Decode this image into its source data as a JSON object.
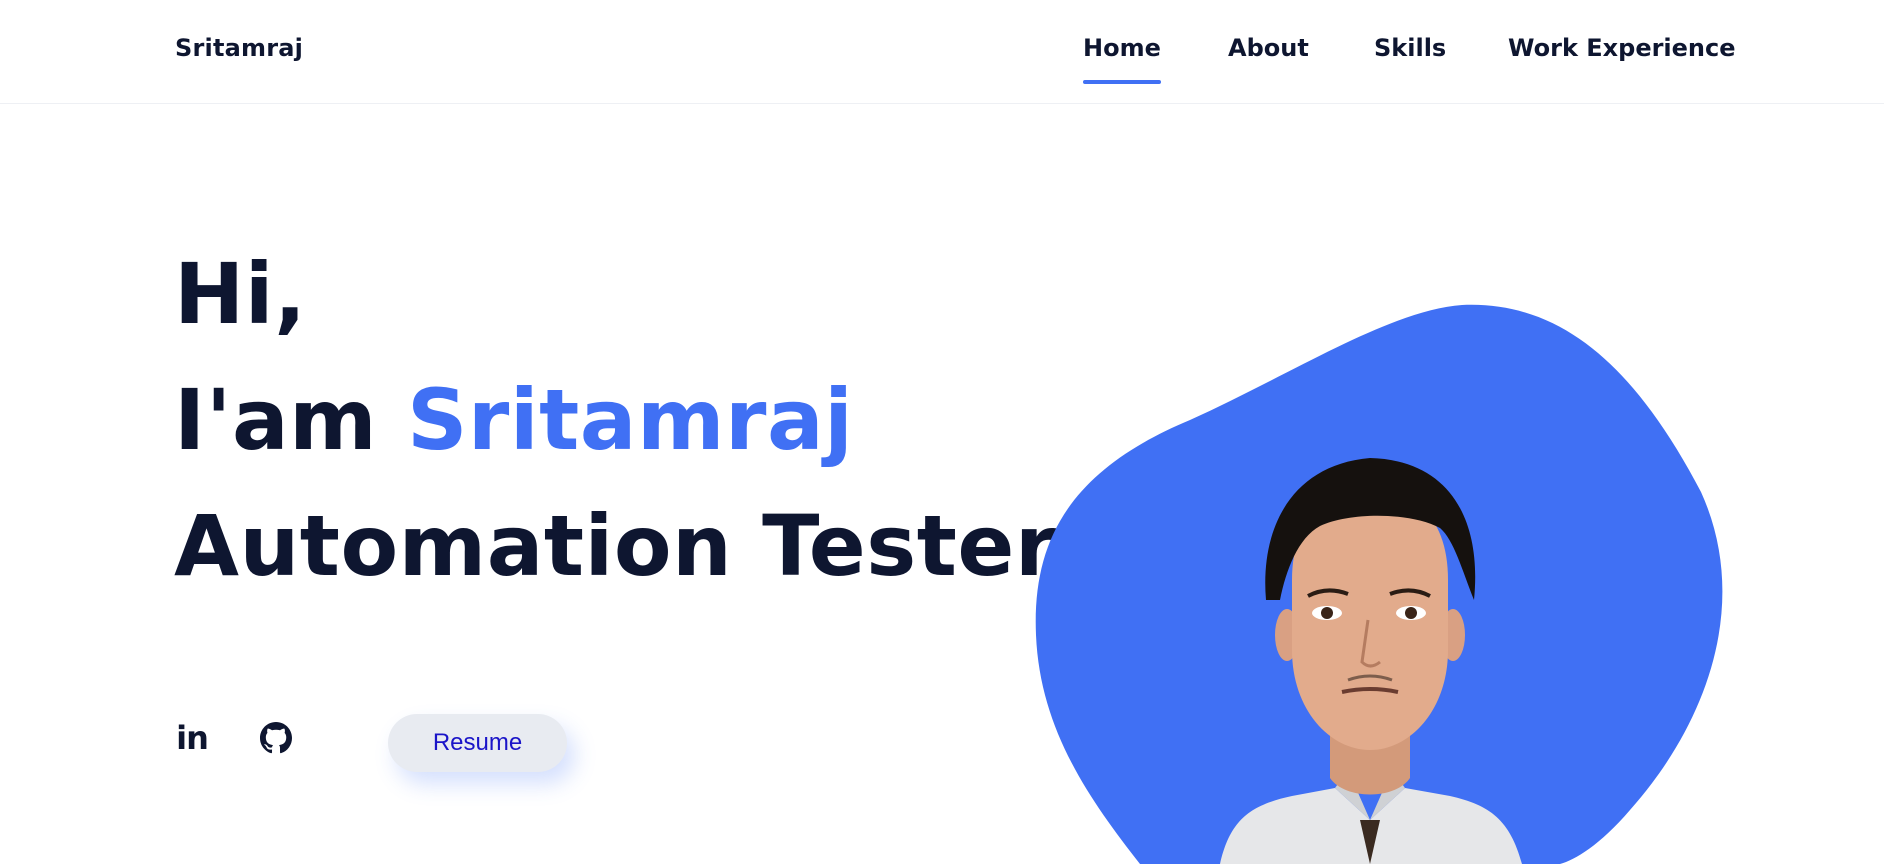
{
  "header": {
    "logo": "Sritamraj",
    "nav": [
      {
        "label": "Home",
        "active": true
      },
      {
        "label": "About",
        "active": false
      },
      {
        "label": "Skills",
        "active": false
      },
      {
        "label": "Work Experience",
        "active": false
      }
    ]
  },
  "hero": {
    "line1": "Hi,",
    "line2_prefix": "I'am",
    "line2_name": "Sritamraj",
    "line3": "Automation Tester",
    "resume_label": "Resume",
    "social": [
      {
        "name": "linkedin",
        "glyph": "in"
      },
      {
        "name": "github",
        "icon": "github-icon"
      }
    ]
  },
  "colors": {
    "accent": "#4070f4",
    "text_dark": "#0e1630",
    "button_bg": "#e8ebf1",
    "button_text": "#1a14c8"
  }
}
